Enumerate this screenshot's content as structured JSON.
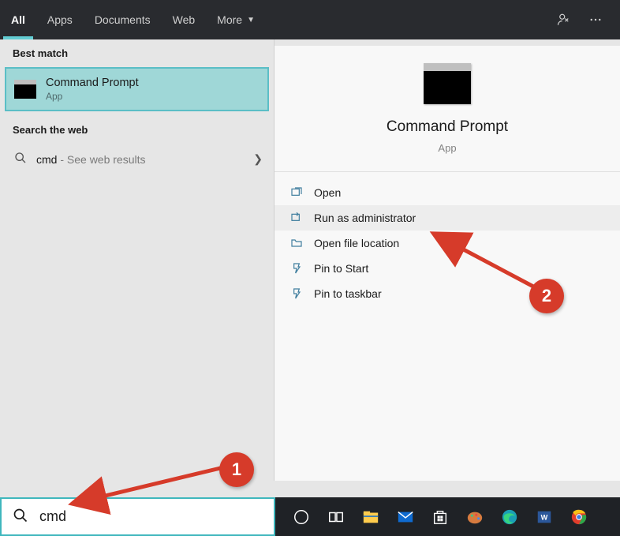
{
  "topbar": {
    "tabs": [
      {
        "label": "All",
        "active": true
      },
      {
        "label": "Apps",
        "active": false
      },
      {
        "label": "Documents",
        "active": false
      },
      {
        "label": "Web",
        "active": false
      },
      {
        "label": "More",
        "active": false,
        "dropdown": true
      }
    ],
    "feedback_icon": "feedback-icon",
    "more_icon": "ellipsis-icon"
  },
  "left": {
    "best_match_header": "Best match",
    "best_match": {
      "title": "Command Prompt",
      "subtitle": "App"
    },
    "search_web_header": "Search the web",
    "web_result": {
      "term": "cmd",
      "hint": " - See web results"
    }
  },
  "right": {
    "title": "Command Prompt",
    "subtitle": "App",
    "actions": [
      {
        "label": "Open",
        "icon": "open-icon",
        "highlight": false
      },
      {
        "label": "Run as administrator",
        "icon": "admin-icon",
        "highlight": true
      },
      {
        "label": "Open file location",
        "icon": "folder-icon",
        "highlight": false
      },
      {
        "label": "Pin to Start",
        "icon": "pin-start-icon",
        "highlight": false
      },
      {
        "label": "Pin to taskbar",
        "icon": "pin-taskbar-icon",
        "highlight": false
      }
    ]
  },
  "search": {
    "value": "cmd",
    "placeholder": ""
  },
  "annotations": {
    "badge1": "1",
    "badge2": "2"
  },
  "colors": {
    "accent": "#63cdd3",
    "badge": "#d63b2a",
    "highlight": "#9fd7d7"
  }
}
